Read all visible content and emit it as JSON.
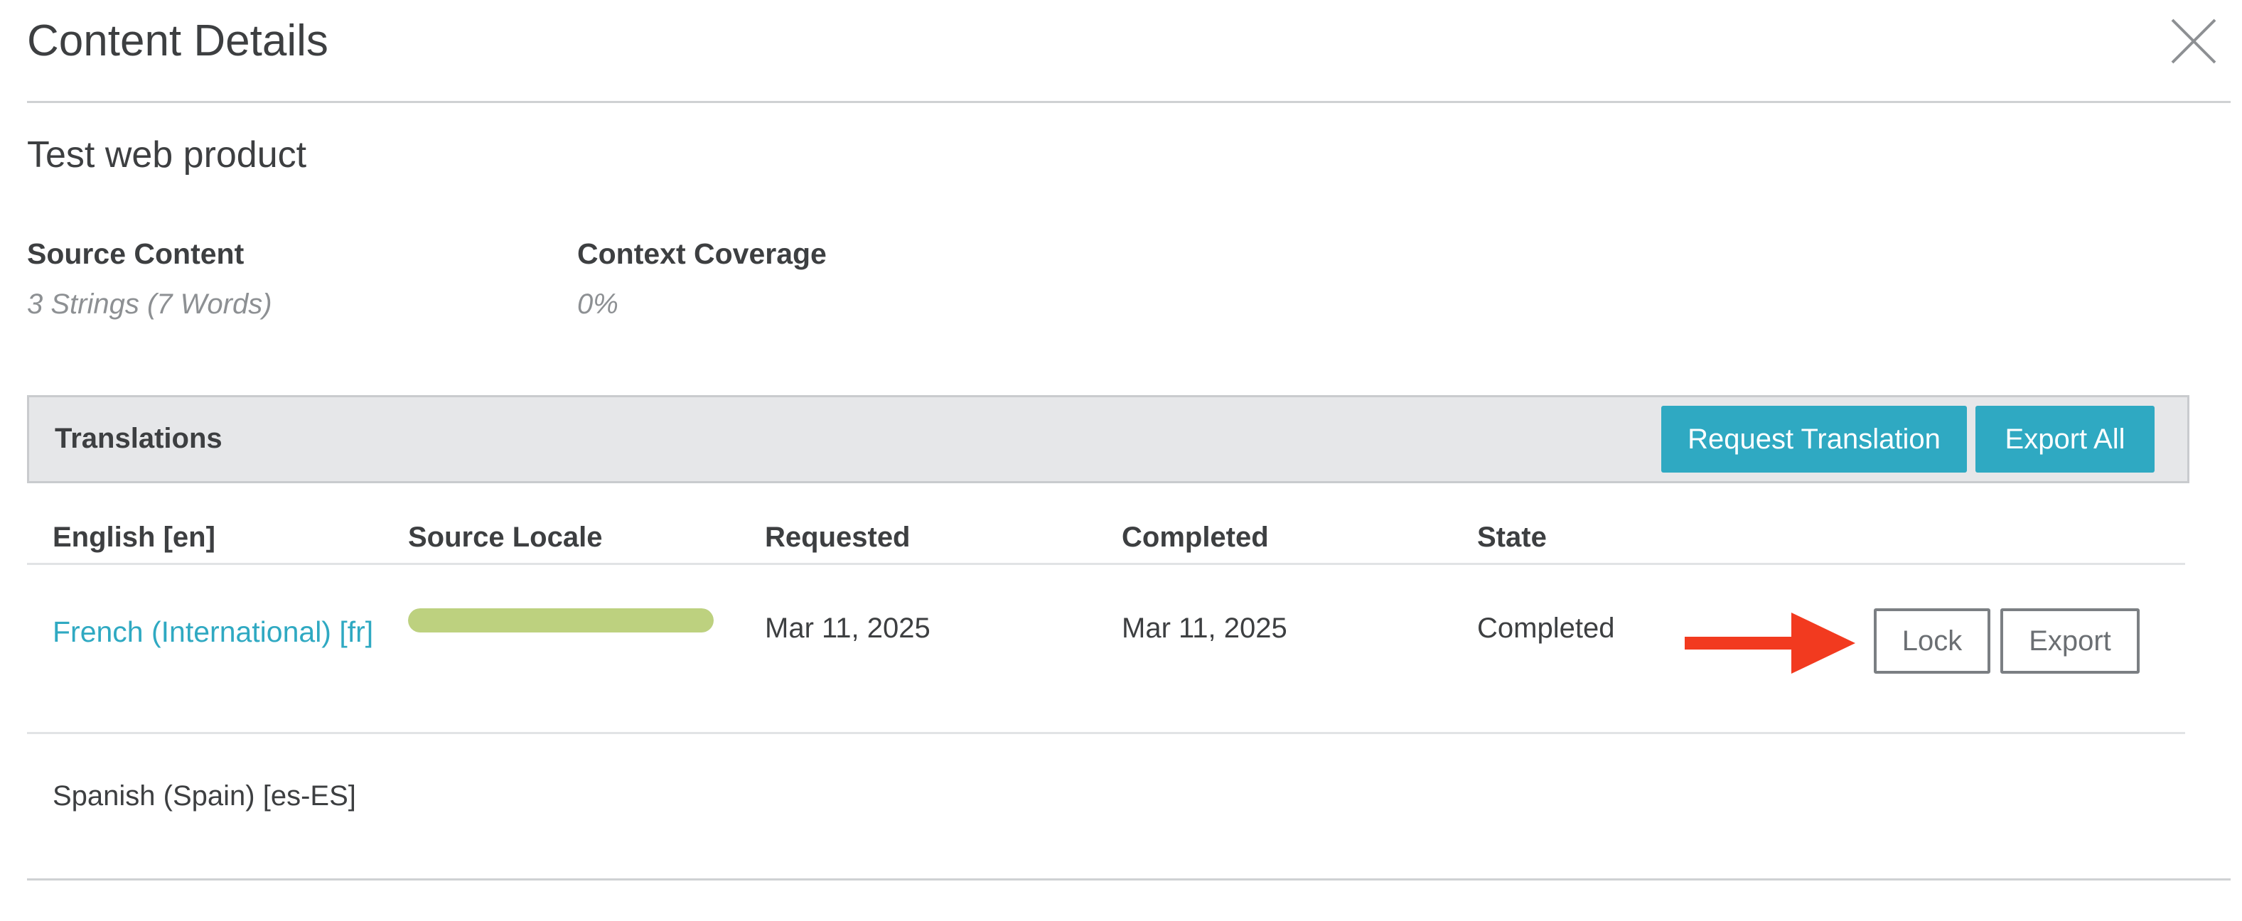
{
  "modal": {
    "title": "Content Details",
    "close_icon": "close-icon"
  },
  "product": {
    "name": "Test web product"
  },
  "source_content": {
    "label": "Source Content",
    "value": "3 Strings (7 Words)"
  },
  "context_coverage": {
    "label": "Context Coverage",
    "value": "0%"
  },
  "translations": {
    "title": "Translations",
    "request_button": "Request Translation",
    "export_all_button": "Export All",
    "columns": [
      "English [en]",
      "Source Locale",
      "Requested",
      "Completed",
      "State"
    ],
    "rows": [
      {
        "locale": "French (International) [fr]",
        "progress": 1.0,
        "requested": "Mar 11, 2025",
        "completed": "Mar 11, 2025",
        "state": "Completed",
        "lock_button": "Lock",
        "export_button": "Export"
      },
      {
        "locale": "Spanish (Spain) [es-ES]"
      }
    ]
  },
  "colors": {
    "accent": "#2fa9c2",
    "progress_fill": "#bdd17f",
    "annotation_arrow": "#f23a1f",
    "bar_background": "#e6e7e9"
  },
  "annotation": {
    "arrow_icon": "arrow-right-icon"
  }
}
